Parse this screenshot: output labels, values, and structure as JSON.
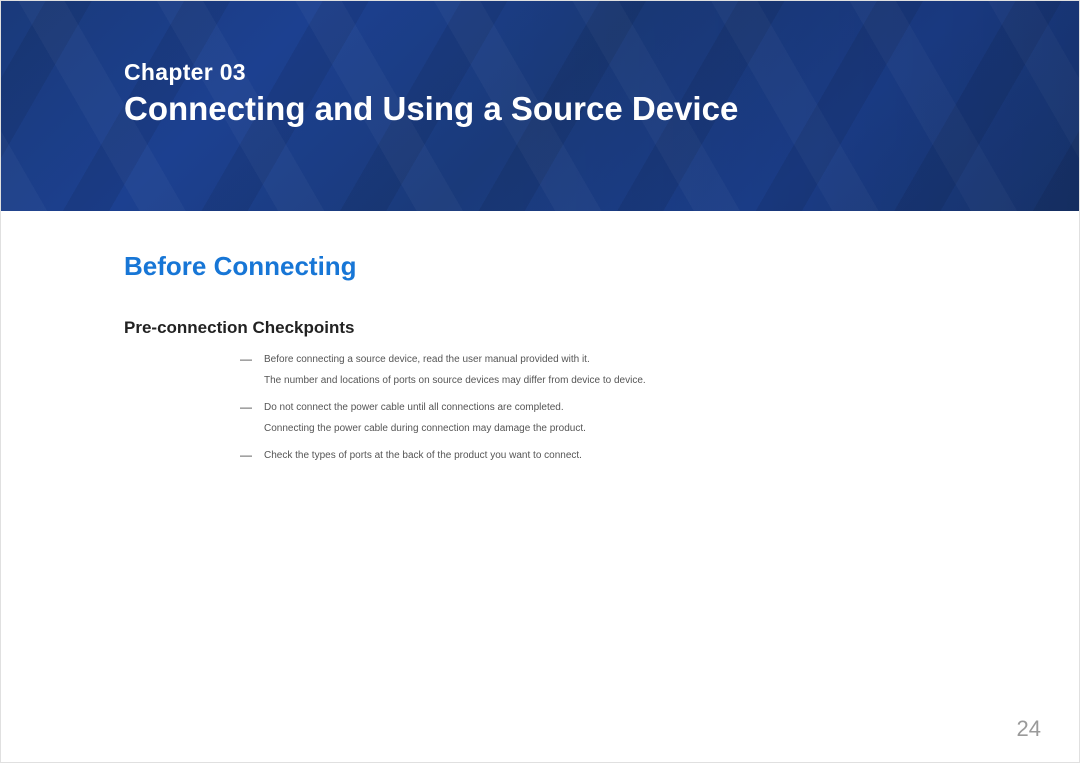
{
  "banner": {
    "chapter_label": "Chapter 03",
    "chapter_title": "Connecting and Using a Source Device"
  },
  "section": {
    "heading": "Before Connecting",
    "sub_heading": "Pre-connection Checkpoints",
    "items": [
      {
        "line1": "Before connecting a source device, read the user manual provided with it.",
        "line2": "The number and locations of ports on source devices may differ from device to device."
      },
      {
        "line1": "Do not connect the power cable until all connections are completed.",
        "line2": "Connecting the power cable during connection may damage the product."
      },
      {
        "line1": "Check the types of ports at the back of the product you want to connect.",
        "line2": ""
      }
    ]
  },
  "page_number": "24"
}
